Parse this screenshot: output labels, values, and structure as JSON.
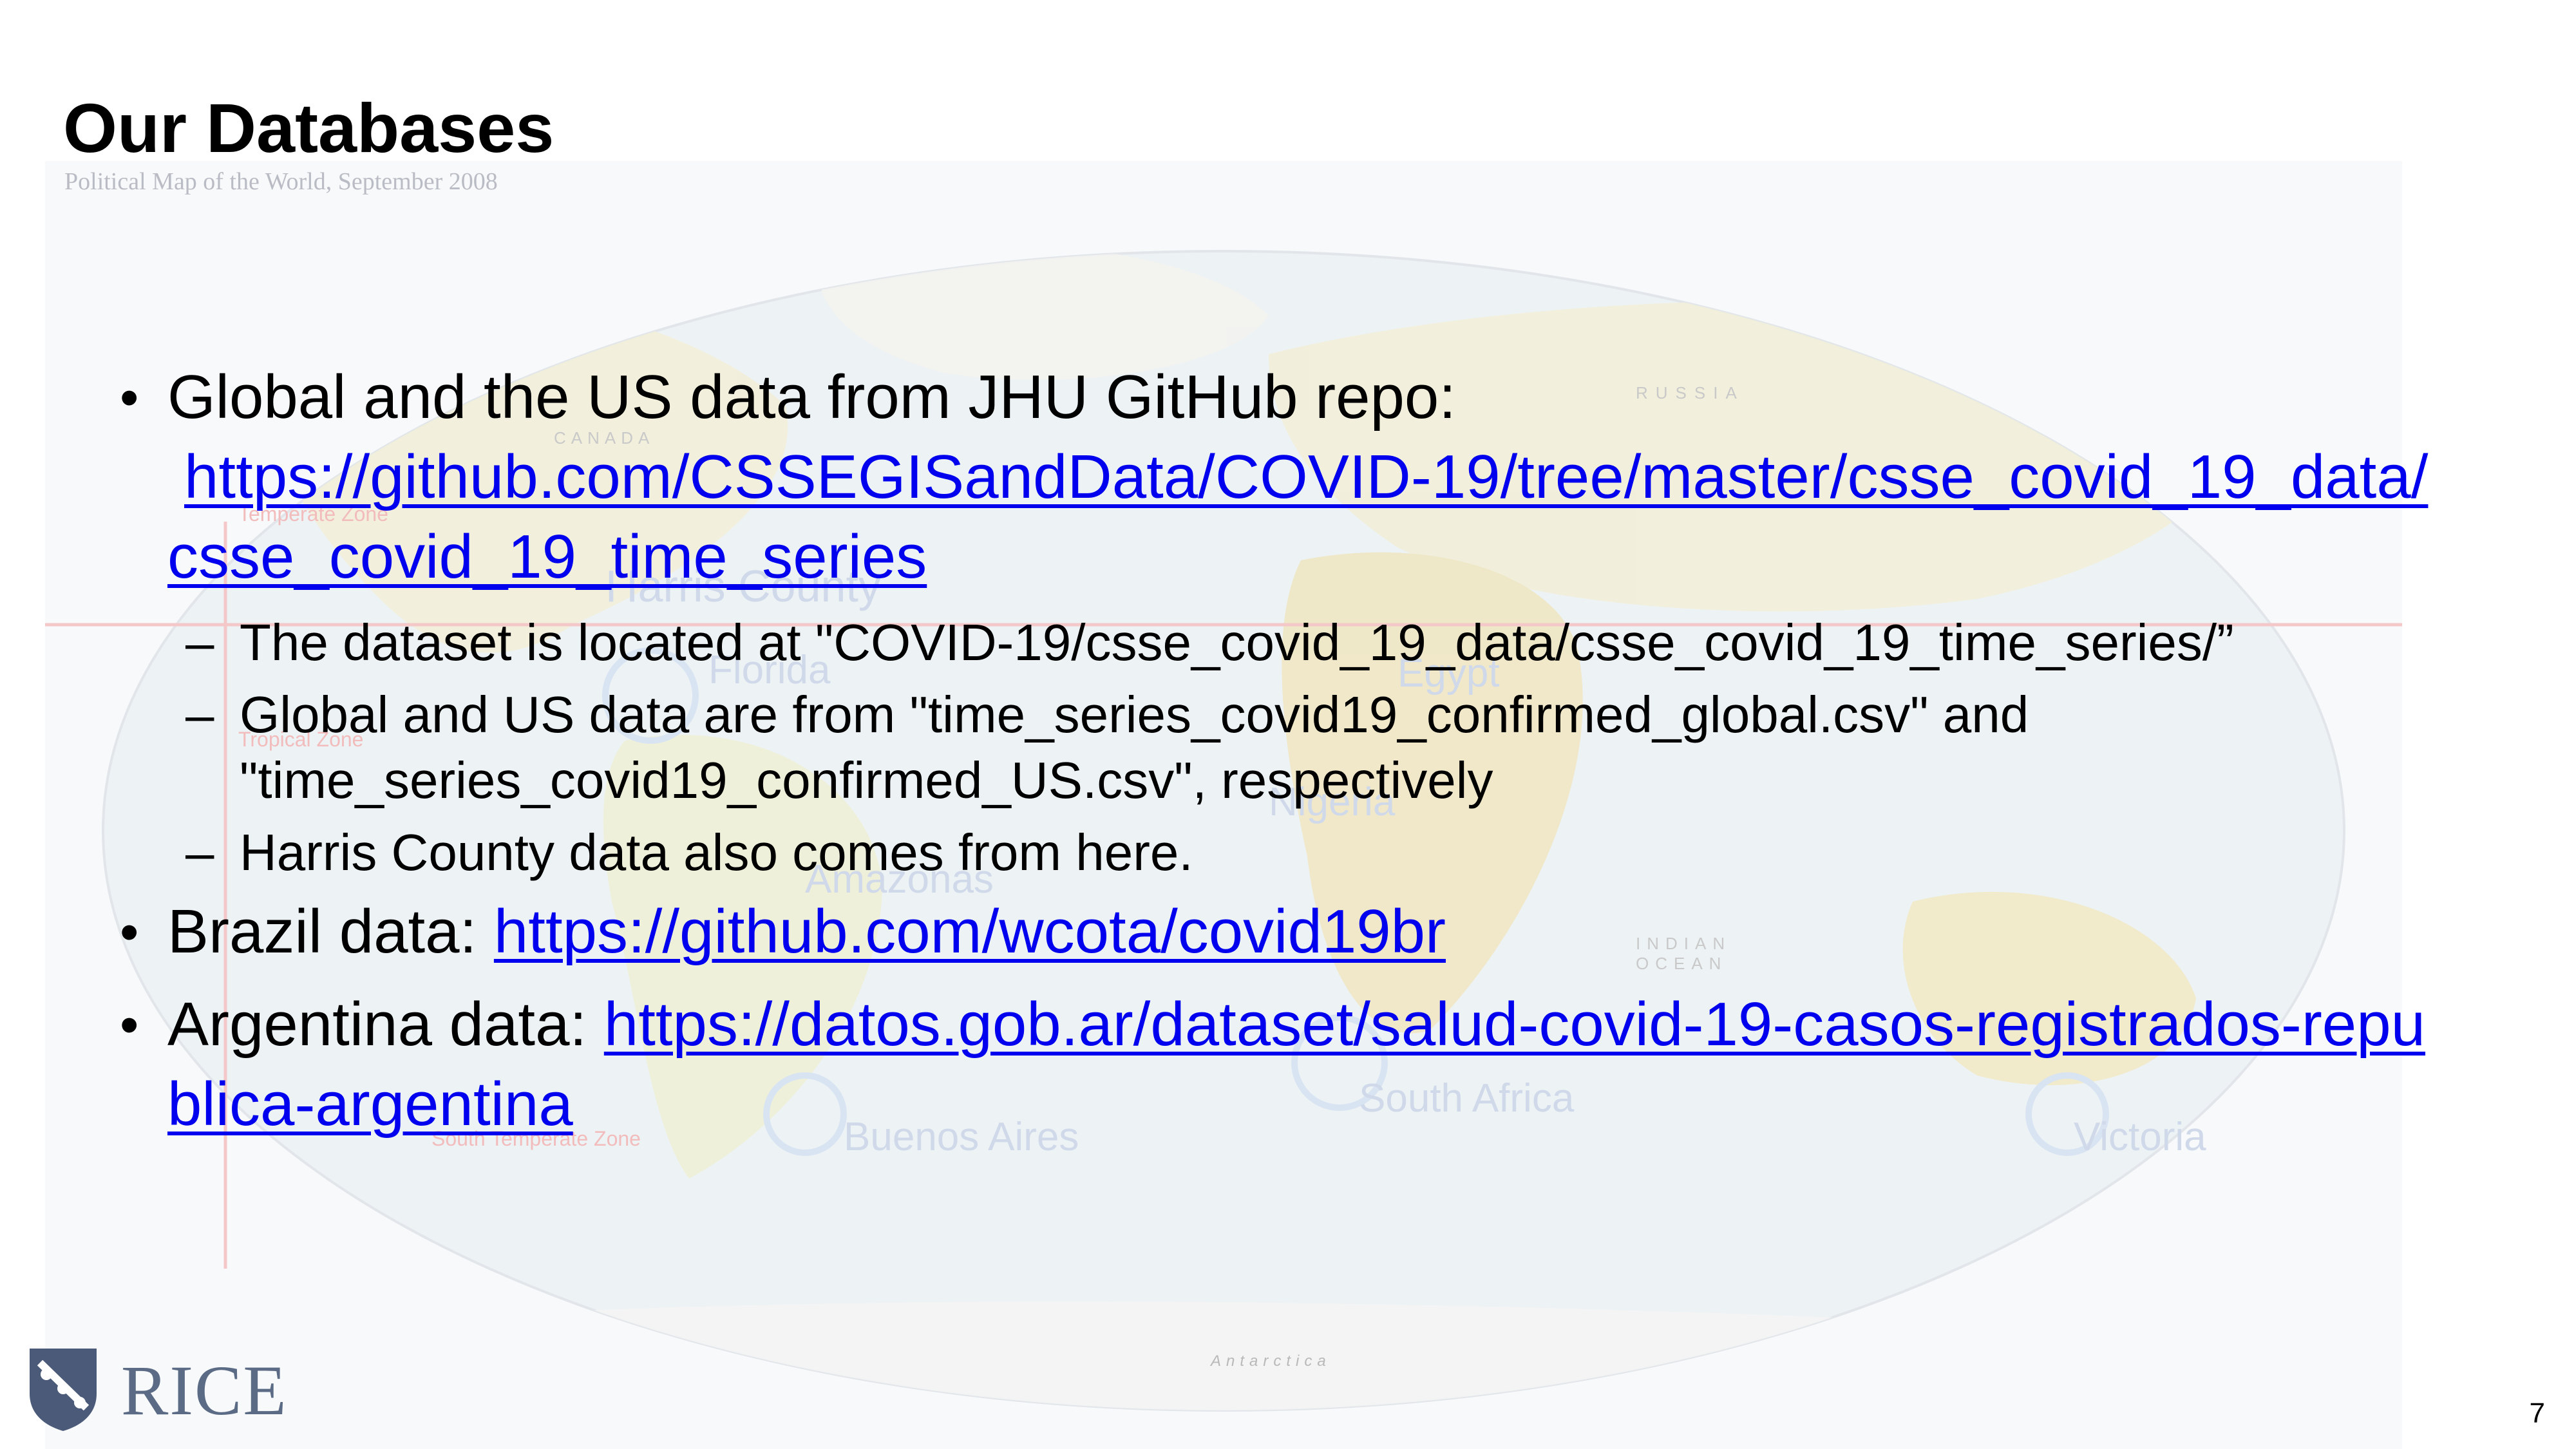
{
  "slide": {
    "title": "Our Databases",
    "page_number": "7"
  },
  "background_map": {
    "caption": "Political Map of the World, September 2008",
    "labels": [
      "RUSSIA",
      "CANADA",
      "Harris County",
      "Florida",
      "Egypt",
      "Nigeria",
      "Amazonas",
      "South Africa",
      "Buenos Aires",
      "Victoria",
      "Antarctica",
      "Temperate Zone",
      "Tropical Zone",
      "South Temperate Zone",
      "INDIAN OCEAN"
    ]
  },
  "bullets": [
    {
      "text": "Global and the US data from JHU GitHub repo:",
      "link": "https://github.com/CSSEGISandData/COVID-19/tree/master/csse_covid_19_data/csse_covid_19_time_series",
      "sub": [
        "The dataset is located at \"COVID-19/csse_covid_19_data/csse_covid_19_time_series/”",
        "Global and US data are from \"time_series_covid19_confirmed_global.csv\" and \"time_series_covid19_confirmed_US.csv\", respectively",
        "Harris County data also comes from here."
      ]
    },
    {
      "text": "Brazil data: ",
      "link": "https://github.com/wcota/covid19br"
    },
    {
      "text": "Argentina data: ",
      "link": "https://datos.gob.ar/dataset/salud-covid-19-casos-registrados-republica-argentina"
    }
  ],
  "logo": {
    "text": "RICE",
    "color": "#5b6b85"
  },
  "colors": {
    "link": "#0000ee",
    "text": "#000000",
    "map_ocean": "#eef3f7",
    "map_land": "#f1ecd2"
  }
}
